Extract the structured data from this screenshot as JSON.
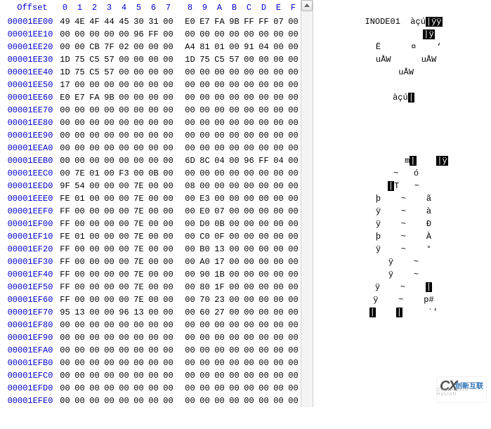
{
  "header": {
    "offset_label": "Offset",
    "cols": [
      "0",
      "1",
      "2",
      "3",
      "4",
      "5",
      "6",
      "7",
      "8",
      "9",
      "A",
      "B",
      "C",
      "D",
      "E",
      "F"
    ]
  },
  "rows": [
    {
      "offset": "00001EE00",
      "hex": [
        "49",
        "4E",
        "4F",
        "44",
        "45",
        "30",
        "31",
        "00",
        "E0",
        "E7",
        "FA",
        "9B",
        "FF",
        "FF",
        "07",
        "00"
      ],
      "ascii": "INODE01  àçú<hl>|ÿÿ</hl>"
    },
    {
      "offset": "00001EE10",
      "hex": [
        "00",
        "00",
        "00",
        "00",
        "00",
        "96",
        "FF",
        "00",
        "00",
        "00",
        "00",
        "00",
        "00",
        "00",
        "00",
        "00"
      ],
      "ascii": "          <hl>|ÿ</hl>"
    },
    {
      "offset": "00001EE20",
      "hex": [
        "00",
        "00",
        "CB",
        "7F",
        "02",
        "00",
        "00",
        "00",
        "A4",
        "81",
        "01",
        "00",
        "91",
        "04",
        "00",
        "00"
      ],
      "ascii": "  Ë      ¤    ‘"
    },
    {
      "offset": "00001EE30",
      "hex": [
        "1D",
        "75",
        "C5",
        "57",
        "00",
        "00",
        "00",
        "00",
        "1D",
        "75",
        "C5",
        "57",
        "00",
        "00",
        "00",
        "00"
      ],
      "ascii": " uÅW      uÅW"
    },
    {
      "offset": "00001EE40",
      "hex": [
        "1D",
        "75",
        "C5",
        "57",
        "00",
        "00",
        "00",
        "00",
        "00",
        "00",
        "00",
        "00",
        "00",
        "00",
        "00",
        "00"
      ],
      "ascii": " uÅW"
    },
    {
      "offset": "00001EE50",
      "hex": [
        "17",
        "00",
        "00",
        "00",
        "00",
        "00",
        "00",
        "00",
        "00",
        "00",
        "00",
        "00",
        "00",
        "00",
        "00",
        "00"
      ],
      "ascii": ""
    },
    {
      "offset": "00001EE60",
      "hex": [
        "E0",
        "E7",
        "FA",
        "9B",
        "00",
        "00",
        "00",
        "00",
        "00",
        "00",
        "00",
        "00",
        "00",
        "00",
        "00",
        "00"
      ],
      "ascii": "àçú<hl>|</hl>"
    },
    {
      "offset": "00001EE70",
      "hex": [
        "00",
        "00",
        "00",
        "00",
        "00",
        "00",
        "00",
        "00",
        "00",
        "00",
        "00",
        "00",
        "00",
        "00",
        "00",
        "00"
      ],
      "ascii": ""
    },
    {
      "offset": "00001EE80",
      "hex": [
        "00",
        "00",
        "00",
        "00",
        "00",
        "00",
        "00",
        "00",
        "00",
        "00",
        "00",
        "00",
        "00",
        "00",
        "00",
        "00"
      ],
      "ascii": ""
    },
    {
      "offset": "00001EE90",
      "hex": [
        "00",
        "00",
        "00",
        "00",
        "00",
        "00",
        "00",
        "00",
        "00",
        "00",
        "00",
        "00",
        "00",
        "00",
        "00",
        "00"
      ],
      "ascii": ""
    },
    {
      "offset": "00001EEA0",
      "hex": [
        "00",
        "00",
        "00",
        "00",
        "00",
        "00",
        "00",
        "00",
        "00",
        "00",
        "00",
        "00",
        "00",
        "00",
        "00",
        "00"
      ],
      "ascii": ""
    },
    {
      "offset": "00001EEB0",
      "hex": [
        "00",
        "00",
        "00",
        "00",
        "00",
        "00",
        "00",
        "00",
        "6D",
        "8C",
        "04",
        "00",
        "96",
        "FF",
        "04",
        "00"
      ],
      "ascii": "         m<hl>|</hl>    <hl>|ÿ</hl>"
    },
    {
      "offset": "00001EEC0",
      "hex": [
        "00",
        "7E",
        "01",
        "00",
        "F3",
        "00",
        "0B",
        "00",
        "00",
        "00",
        "00",
        "00",
        "00",
        "00",
        "00",
        "00"
      ],
      "ascii": " ~   ó"
    },
    {
      "offset": "00001EED0",
      "hex": [
        "9F",
        "54",
        "00",
        "00",
        "00",
        "7E",
        "00",
        "00",
        "08",
        "00",
        "00",
        "00",
        "00",
        "00",
        "00",
        "00"
      ],
      "ascii": "<hl>|</hl>T   ~"
    },
    {
      "offset": "00001EEE0",
      "hex": [
        "FE",
        "01",
        "00",
        "00",
        "00",
        "7E",
        "00",
        "00",
        "00",
        "E3",
        "00",
        "00",
        "00",
        "00",
        "00",
        "00"
      ],
      "ascii": "þ    ~    ã"
    },
    {
      "offset": "00001EEF0",
      "hex": [
        "FF",
        "00",
        "00",
        "00",
        "00",
        "7E",
        "00",
        "00",
        "00",
        "E0",
        "07",
        "00",
        "00",
        "00",
        "00",
        "00"
      ],
      "ascii": "ÿ    ~    à"
    },
    {
      "offset": "00001EF00",
      "hex": [
        "FF",
        "00",
        "00",
        "00",
        "00",
        "7E",
        "00",
        "00",
        "00",
        "D0",
        "0B",
        "00",
        "00",
        "00",
        "00",
        "00"
      ],
      "ascii": "ÿ    ~    Ð"
    },
    {
      "offset": "00001EF10",
      "hex": [
        "FE",
        "01",
        "00",
        "00",
        "00",
        "7E",
        "00",
        "00",
        "00",
        "C0",
        "0F",
        "00",
        "00",
        "00",
        "00",
        "00"
      ],
      "ascii": "þ    ~    À"
    },
    {
      "offset": "00001EF20",
      "hex": [
        "FF",
        "00",
        "00",
        "00",
        "00",
        "7E",
        "00",
        "00",
        "00",
        "B0",
        "13",
        "00",
        "00",
        "00",
        "00",
        "00"
      ],
      "ascii": "ÿ    ~    °"
    },
    {
      "offset": "00001EF30",
      "hex": [
        "FF",
        "00",
        "00",
        "00",
        "00",
        "7E",
        "00",
        "00",
        "00",
        "A0",
        "17",
        "00",
        "00",
        "00",
        "00",
        "00"
      ],
      "ascii": "ÿ    ~"
    },
    {
      "offset": "00001EF40",
      "hex": [
        "FF",
        "00",
        "00",
        "00",
        "00",
        "7E",
        "00",
        "00",
        "00",
        "90",
        "1B",
        "00",
        "00",
        "00",
        "00",
        "00"
      ],
      "ascii": "ÿ    ~"
    },
    {
      "offset": "00001EF50",
      "hex": [
        "FF",
        "00",
        "00",
        "00",
        "00",
        "7E",
        "00",
        "00",
        "00",
        "80",
        "1F",
        "00",
        "00",
        "00",
        "00",
        "00"
      ],
      "ascii": "ÿ    ~    <hl>|</hl>"
    },
    {
      "offset": "00001EF60",
      "hex": [
        "FF",
        "00",
        "00",
        "00",
        "00",
        "7E",
        "00",
        "00",
        "00",
        "70",
        "23",
        "00",
        "00",
        "00",
        "00",
        "00"
      ],
      "ascii": "ÿ    ~    p#"
    },
    {
      "offset": "00001EF70",
      "hex": [
        "95",
        "13",
        "00",
        "00",
        "96",
        "13",
        "00",
        "00",
        "00",
        "60",
        "27",
        "00",
        "00",
        "00",
        "00",
        "00"
      ],
      "ascii": "<hl>|</hl>    <hl>|</hl>     `'"
    },
    {
      "offset": "00001EF80",
      "hex": [
        "00",
        "00",
        "00",
        "00",
        "00",
        "00",
        "00",
        "00",
        "00",
        "00",
        "00",
        "00",
        "00",
        "00",
        "00",
        "00"
      ],
      "ascii": ""
    },
    {
      "offset": "00001EF90",
      "hex": [
        "00",
        "00",
        "00",
        "00",
        "00",
        "00",
        "00",
        "00",
        "00",
        "00",
        "00",
        "00",
        "00",
        "00",
        "00",
        "00"
      ],
      "ascii": ""
    },
    {
      "offset": "00001EFA0",
      "hex": [
        "00",
        "00",
        "00",
        "00",
        "00",
        "00",
        "00",
        "00",
        "00",
        "00",
        "00",
        "00",
        "00",
        "00",
        "00",
        "00"
      ],
      "ascii": ""
    },
    {
      "offset": "00001EFB0",
      "hex": [
        "00",
        "00",
        "00",
        "00",
        "00",
        "00",
        "00",
        "00",
        "00",
        "00",
        "00",
        "00",
        "00",
        "00",
        "00",
        "00"
      ],
      "ascii": ""
    },
    {
      "offset": "00001EFC0",
      "hex": [
        "00",
        "00",
        "00",
        "00",
        "00",
        "00",
        "00",
        "00",
        "00",
        "00",
        "00",
        "00",
        "00",
        "00",
        "00",
        "00"
      ],
      "ascii": ""
    },
    {
      "offset": "00001EFD0",
      "hex": [
        "00",
        "00",
        "00",
        "00",
        "00",
        "00",
        "00",
        "00",
        "00",
        "00",
        "00",
        "00",
        "00",
        "00",
        "00",
        "00"
      ],
      "ascii": ""
    },
    {
      "offset": "00001EFE0",
      "hex": [
        "00",
        "00",
        "00",
        "00",
        "00",
        "00",
        "00",
        "00",
        "00",
        "00",
        "00",
        "00",
        "00",
        "00",
        "00",
        "00"
      ],
      "ascii": ""
    }
  ],
  "watermark": {
    "logo": "CX",
    "text": "创新互联",
    "sub": "CHUANGXIN HULIAN"
  }
}
